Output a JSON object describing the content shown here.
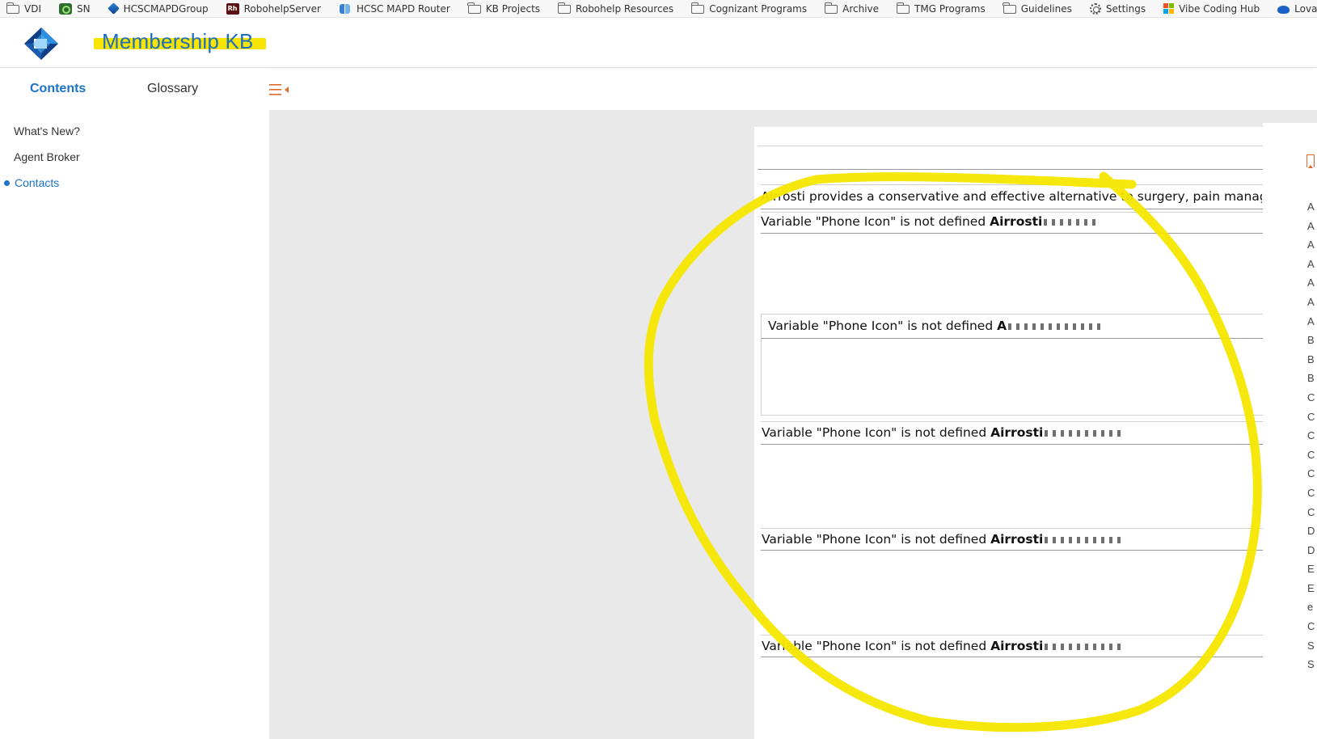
{
  "bookmarks": [
    {
      "label": "VDI",
      "icon": "folder-icon"
    },
    {
      "label": "SN",
      "icon": "servicenow-icon"
    },
    {
      "label": "HCSCMAPDGroup",
      "icon": "diamond-app-icon"
    },
    {
      "label": "RobohelpServer",
      "icon": "robohelp-icon"
    },
    {
      "label": "HCSC MAPD Router",
      "icon": "router-icon"
    },
    {
      "label": "KB Projects",
      "icon": "folder-icon"
    },
    {
      "label": "Robohelp Resources",
      "icon": "folder-icon"
    },
    {
      "label": "Cognizant Programs",
      "icon": "folder-icon"
    },
    {
      "label": "Archive",
      "icon": "folder-icon"
    },
    {
      "label": "TMG Programs",
      "icon": "folder-icon"
    },
    {
      "label": "Guidelines",
      "icon": "folder-icon"
    },
    {
      "label": "Settings",
      "icon": "gear-icon"
    },
    {
      "label": "Vibe Coding Hub",
      "icon": "microsoft-icon"
    },
    {
      "label": "Lovable - Build fo",
      "icon": "lovable-icon"
    }
  ],
  "header": {
    "title": "Membership KB",
    "highlight_color": "#f7e400",
    "title_color": "#1f6fbf"
  },
  "sidebar": {
    "tabs": [
      {
        "label": "Contents",
        "active": true
      },
      {
        "label": "Glossary",
        "active": false
      }
    ],
    "collapse_icon": "collapse-menu-icon",
    "toc": [
      {
        "label": "What's New?",
        "active": false
      },
      {
        "label": "Agent Broker",
        "active": false
      },
      {
        "label": "Contacts",
        "active": true
      }
    ],
    "accent_color": "#1a73c7"
  },
  "content": {
    "intro": "Airrosti provides a conservative and effective alternative to surgery, pain managem",
    "rows": [
      {
        "prefix": "Variable \"Phone Icon\" is not defined ",
        "bold": "Airrosti"
      },
      {
        "prefix": "Variable \"Phone Icon\" is not defined ",
        "bold": "A"
      },
      {
        "prefix": "Variable \"Phone Icon\" is not defined ",
        "bold": "Airrosti"
      },
      {
        "prefix": "Variable \"Phone Icon\" is not defined ",
        "bold": "Airrosti"
      },
      {
        "prefix": "Variable \"Phone Icon\" is not defined ",
        "bold": "Airrosti"
      }
    ]
  },
  "index_letters": [
    "A",
    "A",
    "A",
    "A",
    "A",
    "A",
    "A",
    "B",
    "B",
    "B",
    "C",
    "C",
    "C",
    "C",
    "C",
    "C",
    "C",
    "D",
    "D",
    "E",
    "E",
    "e",
    "C",
    "S",
    "S"
  ],
  "annotation_color": "#f5e600",
  "bookmark_icon": "bookmark-icon"
}
